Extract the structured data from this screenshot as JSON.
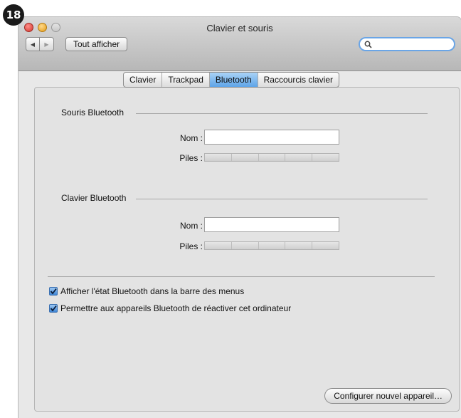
{
  "badge": "18",
  "window": {
    "title": "Clavier et souris",
    "show_all_label": "Tout afficher",
    "search_placeholder": ""
  },
  "tabs": [
    {
      "label": "Clavier",
      "active": false
    },
    {
      "label": "Trackpad",
      "active": false
    },
    {
      "label": "Bluetooth",
      "active": true
    },
    {
      "label": "Raccourcis clavier",
      "active": false
    }
  ],
  "mouse_section": {
    "title": "Souris Bluetooth",
    "name_label": "Nom :",
    "name_value": "",
    "battery_label": "Piles :"
  },
  "keyboard_section": {
    "title": "Clavier Bluetooth",
    "name_label": "Nom :",
    "name_value": "",
    "battery_label": "Piles :"
  },
  "options": {
    "show_status": {
      "label": "Afficher l'état Bluetooth dans la barre des menus",
      "checked": true
    },
    "allow_wake": {
      "label": "Permettre aux appareils Bluetooth de réactiver cet ordinateur",
      "checked": true
    }
  },
  "configure_button": "Configurer nouvel appareil…",
  "colors": {
    "tab_active": "#5ea4e8",
    "search_ring": "#6aa5e6",
    "close_light": "#d2352c",
    "minimize_light": "#e39b16"
  }
}
